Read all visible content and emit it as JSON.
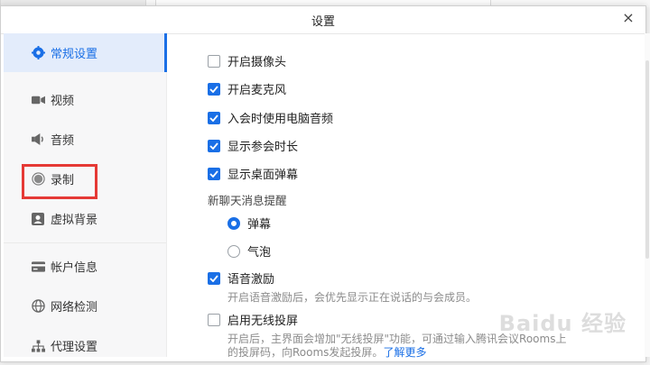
{
  "dialog": {
    "title": "设置",
    "close_symbol": "×"
  },
  "sidebar": {
    "items": [
      {
        "label": "常规设置",
        "icon": "gear-icon",
        "active": true
      },
      {
        "label": "视频",
        "icon": "video-icon"
      },
      {
        "label": "音频",
        "icon": "speaker-icon"
      },
      {
        "label": "录制",
        "icon": "record-icon"
      },
      {
        "label": "虚拟背景",
        "icon": "portrait-icon"
      },
      {
        "label": "帐户信息",
        "icon": "card-icon"
      },
      {
        "label": "网络检测",
        "icon": "globe-icon"
      },
      {
        "label": "代理设置",
        "icon": "network-icon"
      }
    ]
  },
  "general": {
    "camera": {
      "label": "开启摄像头",
      "checked": false
    },
    "mic": {
      "label": "开启麦克风",
      "checked": true
    },
    "computer_audio": {
      "label": "入会时使用电脑音频",
      "checked": true
    },
    "duration": {
      "label": "显示参会时长",
      "checked": true
    },
    "popup": {
      "label": "显示桌面弹幕",
      "checked": true
    },
    "chat_reminder_label": "新聊天消息提醒",
    "chat_options": [
      {
        "label": "弹幕",
        "selected": true
      },
      {
        "label": "气泡",
        "selected": false
      }
    ],
    "voice_encourage": {
      "label": "语音激励",
      "checked": true,
      "desc": "开启语音激励后，会优先显示正在说话的与会成员。"
    },
    "wireless": {
      "label": "启用无线投屏",
      "checked": false,
      "desc1": "开启后，主界面会增加\"无线投屏\"功能，可通过输入腾讯会议Rooms上",
      "desc2": "的投屏码，向Rooms发起投屏。",
      "link": "了解更多"
    }
  },
  "watermark": "Baidu 经验",
  "colors": {
    "accent": "#1a6fe6",
    "highlight_border": "#e53935"
  }
}
